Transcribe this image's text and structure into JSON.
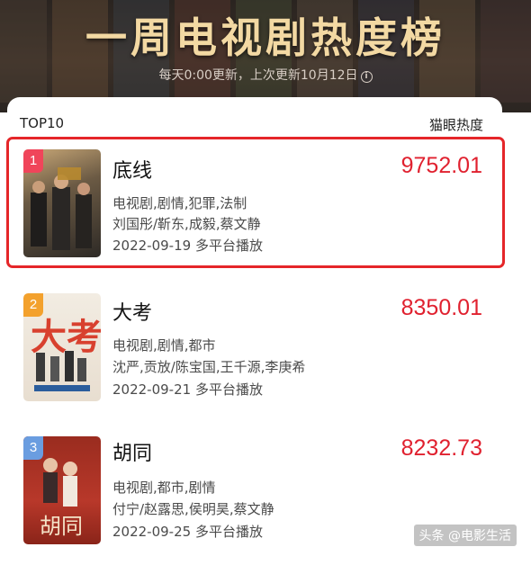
{
  "header": {
    "title": "一周电视剧热度榜",
    "subtitle": "每天0:00更新，上次更新10月12日",
    "info_icon": "info-icon"
  },
  "list": {
    "left_label": "TOP10",
    "right_label": "猫眼热度"
  },
  "items": [
    {
      "rank": "1",
      "name": "底线",
      "score": "9752.01",
      "genres": "电视剧,剧情,犯罪,法制",
      "cast": "刘国彤/靳东,成毅,蔡文静",
      "release": "2022-09-19 多平台播放",
      "rank_color": "#f0455a",
      "highlighted": true
    },
    {
      "rank": "2",
      "name": "大考",
      "score": "8350.01",
      "genres": "电视剧,剧情,都市",
      "cast": "沈严,贡放/陈宝国,王千源,李庚希",
      "release": "2022-09-21 多平台播放",
      "rank_color": "#f3a12d",
      "highlighted": false
    },
    {
      "rank": "3",
      "name": "胡同",
      "score": "8232.73",
      "genres": "电视剧,都市,剧情",
      "cast": "付宁/赵露思,侯明昊,蔡文静",
      "release": "2022-09-25 多平台播放",
      "rank_color": "#6a9de0",
      "highlighted": false
    }
  ],
  "watermark": "头条 @电影生活",
  "colors": {
    "score": "#e0212f",
    "highlight_border": "#e52629",
    "title_gold": "#f3d9a3"
  }
}
